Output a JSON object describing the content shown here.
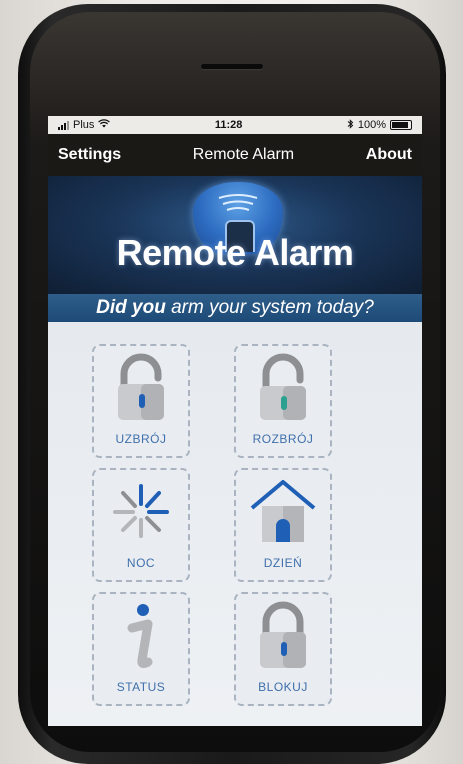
{
  "status_bar": {
    "carrier": "Plus",
    "time": "11:28",
    "battery": "100%"
  },
  "nav": {
    "left": "Settings",
    "title": "Remote Alarm",
    "right": "About"
  },
  "banner": {
    "logo_text": "Remote Alarm",
    "tagline_strong": "Did you",
    "tagline_rest": " arm your system today?"
  },
  "tiles": [
    {
      "label": "UZBRÓJ",
      "icon": "padlock-open-icon"
    },
    {
      "label": "ROZBRÓJ",
      "icon": "padlock-closed-icon"
    },
    {
      "label": "NOC",
      "icon": "night-spinner-icon"
    },
    {
      "label": "DZIEŃ",
      "icon": "house-icon"
    },
    {
      "label": "STATUS",
      "icon": "info-icon"
    },
    {
      "label": "BLOKUJ",
      "icon": "padlock-lock-icon"
    }
  ],
  "colors": {
    "accent_blue": "#1f5fb5",
    "label_blue": "#3f6fab",
    "nav_bg": "#1a1916"
  }
}
